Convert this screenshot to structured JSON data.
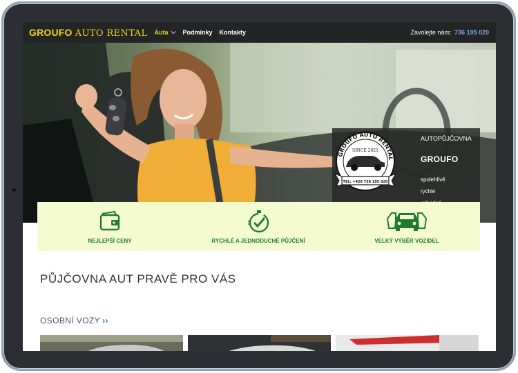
{
  "navbar": {
    "logo_brand": "GROUFO",
    "logo_rest": "AUTO RENTAL",
    "menu": [
      {
        "label": "Auta",
        "has_dropdown": true,
        "active": true
      },
      {
        "label": "Podmínky",
        "has_dropdown": false,
        "active": false
      },
      {
        "label": "Kontakty",
        "has_dropdown": false,
        "active": false
      }
    ],
    "call_label": "Zavolejte nám:",
    "phone": "736 195 020"
  },
  "hero": {
    "info_title": "AUTOPŮJČOVNA",
    "info_name": "GROUFO",
    "info_lines": [
      "spolehlivě",
      "rychle",
      "výhodné"
    ],
    "badge": {
      "top_text": "GROUFO AUTO RENTAL",
      "since": "SINCE 2021",
      "phone": "TEL: +420 736 195 020"
    }
  },
  "features": [
    {
      "label": "NEJLEPŠÍ CENY",
      "icon": "wallet-icon"
    },
    {
      "label": "RYCHLÉ A JEDNODUCHÉ PŮJČENÍ",
      "icon": "stopwatch-check-icon"
    },
    {
      "label": "VELKÝ VÝBĚR VOZIDEL",
      "icon": "cars-icon"
    }
  ],
  "main": {
    "title": "PŮJČOVNA AUT PRAVĚ PRO VÁS",
    "subtitle": "OSOBNÍ VOZY",
    "subtitle_arrows": "››"
  },
  "colors": {
    "accent_yellow": "#f2d21b",
    "nav_bg": "#222426",
    "feature_bg": "#f5fbd0",
    "feature_green": "#1e7d2c",
    "link_blue": "#2a6fc9"
  }
}
